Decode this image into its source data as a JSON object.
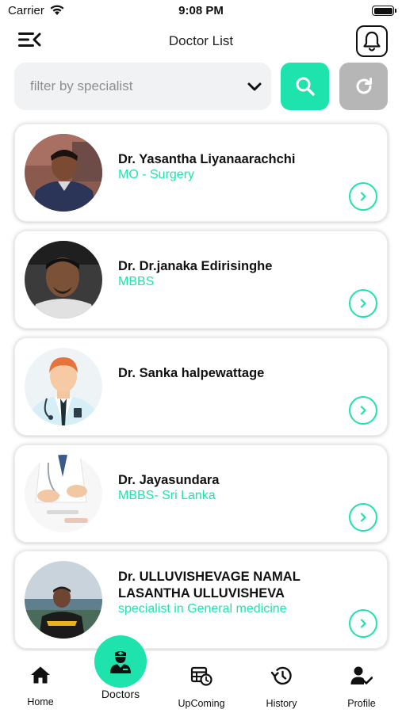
{
  "status_bar": {
    "carrier": "Carrier",
    "time": "9:08 PM"
  },
  "header": {
    "title": "Doctor List"
  },
  "filter": {
    "placeholder": "filter by specialist"
  },
  "colors": {
    "accent": "#1ee3ad",
    "refresh_bg": "#b6b6b6",
    "input_bg": "#f1f2f3"
  },
  "doctors": [
    {
      "name": "Dr. Yasantha Liyanaarachchi",
      "specialty": "MO - Surgery",
      "avatar": "photo-man-dark-jacket"
    },
    {
      "name": "Dr. Dr.janaka Edirisinghe",
      "specialty": "MBBS",
      "avatar": "photo-man-selfie"
    },
    {
      "name": "Dr. Sanka halpewattage",
      "specialty": "",
      "avatar": "doctor-illustration"
    },
    {
      "name": "Dr. Jayasundara",
      "specialty": "MBBS- Sri Lanka",
      "avatar": "photo-doctor-hands"
    },
    {
      "name": "Dr. ULLUVISHEVAGE NAMAL LASANTHA ULLUVISHEVA",
      "specialty": "specialist in General medicine",
      "avatar": "photo-man-outdoors"
    }
  ],
  "nav": {
    "home": "Home",
    "doctors": "Doctors",
    "upcoming": "UpComing",
    "history": "History",
    "profile": "Profile"
  }
}
